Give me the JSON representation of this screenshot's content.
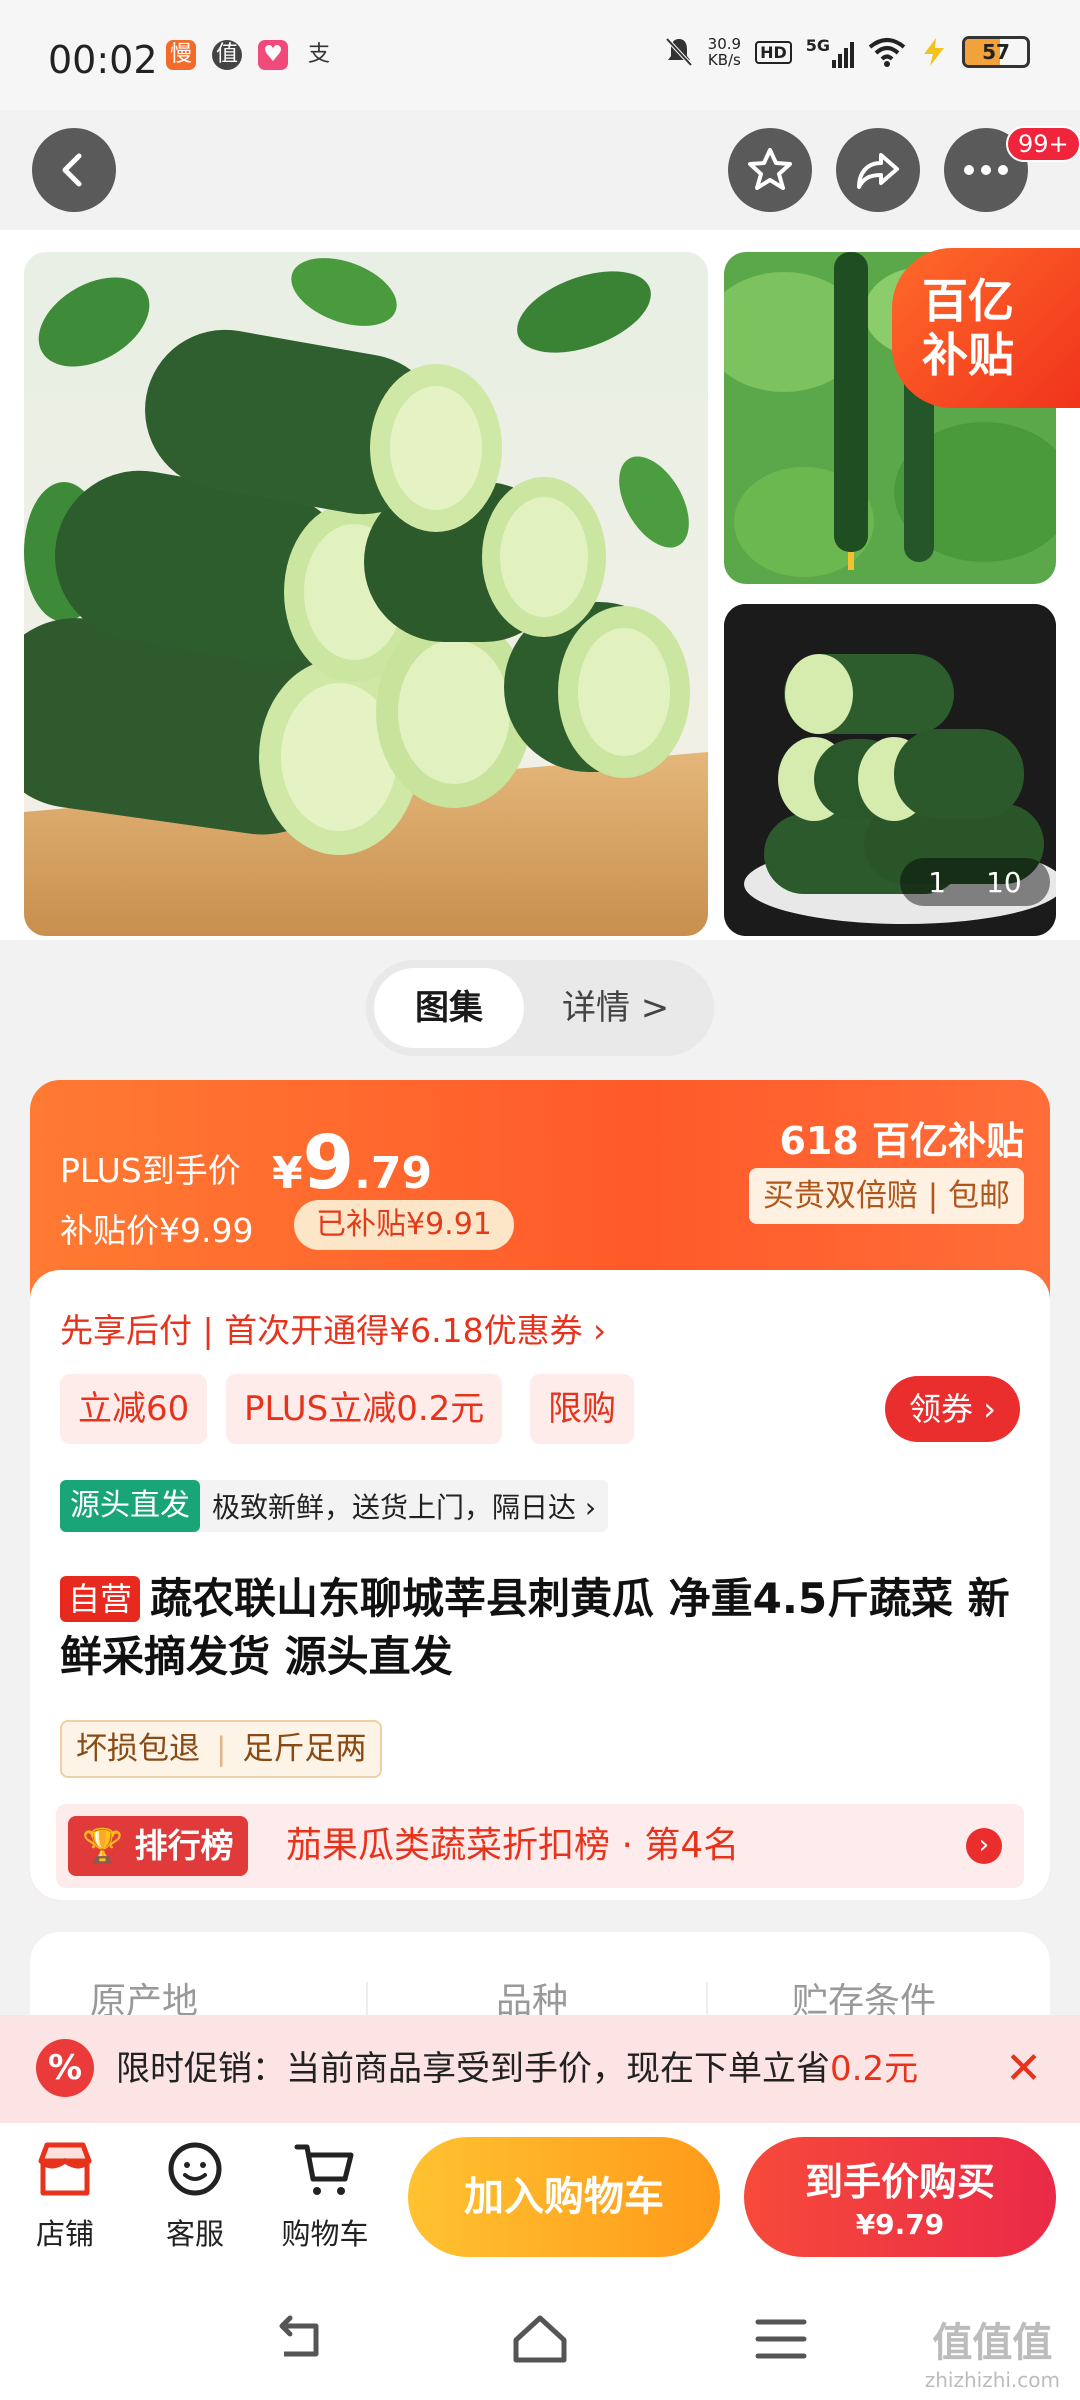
{
  "status_bar": {
    "time": "00:02",
    "net_speed_value": "30.9",
    "net_speed_unit": "KB/s",
    "hd_label": "HD",
    "network": "5G",
    "battery": "57"
  },
  "top_nav": {
    "more_badge": "99+"
  },
  "gallery": {
    "subsidy_line1": "百亿",
    "subsidy_line2": "补贴",
    "pager_current": "1",
    "pager_total": "10"
  },
  "segment": {
    "active": "图集",
    "inactive": "详情 >"
  },
  "price": {
    "plus_label": "PLUS到手价",
    "currency": "¥",
    "int": "9",
    "dec": ".79",
    "subsidy_price": "补贴价¥9.99",
    "subsidy_amount": "已补贴¥9.91",
    "brand_618": "618 百亿补贴",
    "guarantee": "买贵双倍赔 | 包邮"
  },
  "offers": {
    "credit": "先享后付 | 首次开通得¥6.18优惠券 ›",
    "promo1": "立减60",
    "promo2": "PLUS立减0.2元",
    "promo3": "限购",
    "coupon": "领券 ›"
  },
  "origin": {
    "tag": "源头直发",
    "text": "极致新鲜，送货上门，隔日达 ›"
  },
  "product": {
    "self_tag": "自营",
    "title": "蔬农联山东聊城莘县刺黄瓜 净重4.5斤蔬菜 新鲜采摘发货 源头直发",
    "svc1": "坏损包退",
    "svc2": "足斤足两"
  },
  "rank": {
    "tag": "排行榜",
    "text": "茄果瓜类蔬菜折扣榜 · 第4名"
  },
  "attributes": {
    "col1": "原产地",
    "col2": "品种",
    "col3": "贮存条件"
  },
  "banner": {
    "text": "限时促销：当前商品享受到手价，现在下单立省",
    "amount": "0.2元"
  },
  "action_bar": {
    "shop": "店铺",
    "service": "客服",
    "cart": "购物车",
    "add_cart": "加入购物车",
    "buy": "到手价购买",
    "buy_price": "¥9.79"
  },
  "watermark": {
    "main": "值值值",
    "sub": "zhizhizhi.com"
  },
  "colors": {
    "accent_red": "#e8331c",
    "accent_orange": "#ff7a32",
    "cart_yellow": "#ffb224",
    "origin_green": "#1aa578"
  }
}
